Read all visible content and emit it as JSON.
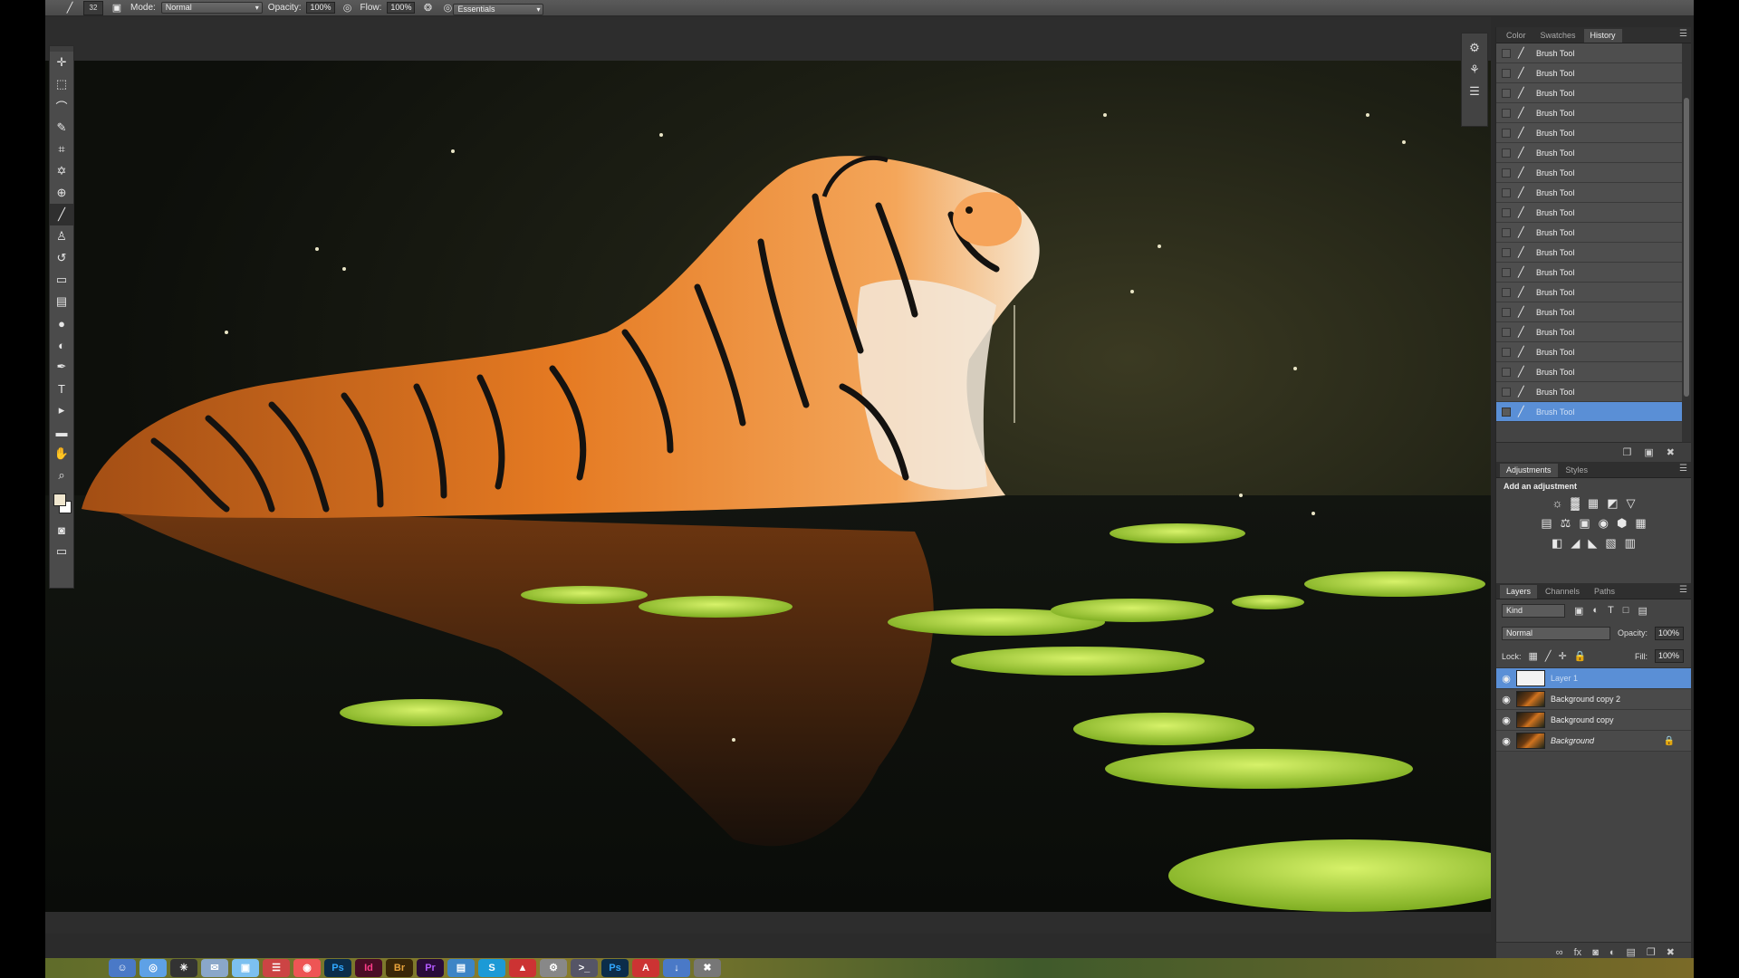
{
  "options_bar": {
    "brush_size": "32",
    "mode_label": "Mode:",
    "mode_value": "Normal",
    "opacity_label": "Opacity:",
    "opacity_value": "100%",
    "flow_label": "Flow:",
    "flow_value": "100%",
    "workspace": "Essentials"
  },
  "toolbox": {
    "tools": [
      "move-tool-icon",
      "marquee-tool-icon",
      "lasso-tool-icon",
      "quick-selection-tool-icon",
      "crop-tool-icon",
      "eyedropper-tool-icon",
      "healing-brush-icon",
      "brush-tool-icon",
      "clone-stamp-icon",
      "history-brush-icon",
      "eraser-tool-icon",
      "gradient-tool-icon",
      "blur-tool-icon",
      "dodge-tool-icon",
      "pen-tool-icon",
      "type-tool-icon",
      "path-selection-icon",
      "shape-tool-icon",
      "hand-tool-icon",
      "zoom-tool-icon"
    ],
    "foreground_color": "#f0e7cf",
    "background_color": "#ffffff"
  },
  "history_panel": {
    "tabs": [
      "Color",
      "Swatches",
      "History"
    ],
    "active_tab": "History",
    "items": [
      "Brush Tool",
      "Brush Tool",
      "Brush Tool",
      "Brush Tool",
      "Brush Tool",
      "Brush Tool",
      "Brush Tool",
      "Brush Tool",
      "Brush Tool",
      "Brush Tool",
      "Brush Tool",
      "Brush Tool",
      "Brush Tool",
      "Brush Tool",
      "Brush Tool",
      "Brush Tool",
      "Brush Tool",
      "Brush Tool",
      "Brush Tool"
    ],
    "selected_index": 18
  },
  "adjustments_panel": {
    "tabs": [
      "Adjustments",
      "Styles"
    ],
    "hint": "Add an adjustment"
  },
  "layers_panel": {
    "tabs": [
      "Layers",
      "Channels",
      "Paths"
    ],
    "filter_kind": "Kind",
    "blend_mode": "Normal",
    "opacity_label": "Opacity:",
    "opacity_value": "100%",
    "lock_label": "Lock:",
    "fill_label": "Fill:",
    "fill_value": "100%",
    "layers": [
      {
        "name": "Layer 1",
        "selected": true
      },
      {
        "name": "Background copy 2",
        "selected": false
      },
      {
        "name": "Background copy",
        "selected": false
      },
      {
        "name": "Background",
        "selected": false,
        "locked": true
      }
    ]
  },
  "canvas": {
    "artwork": "tiger in pond with lily pads"
  },
  "colors": {
    "accent_selection": "#5a8fd6",
    "panel_bg": "#444444"
  }
}
